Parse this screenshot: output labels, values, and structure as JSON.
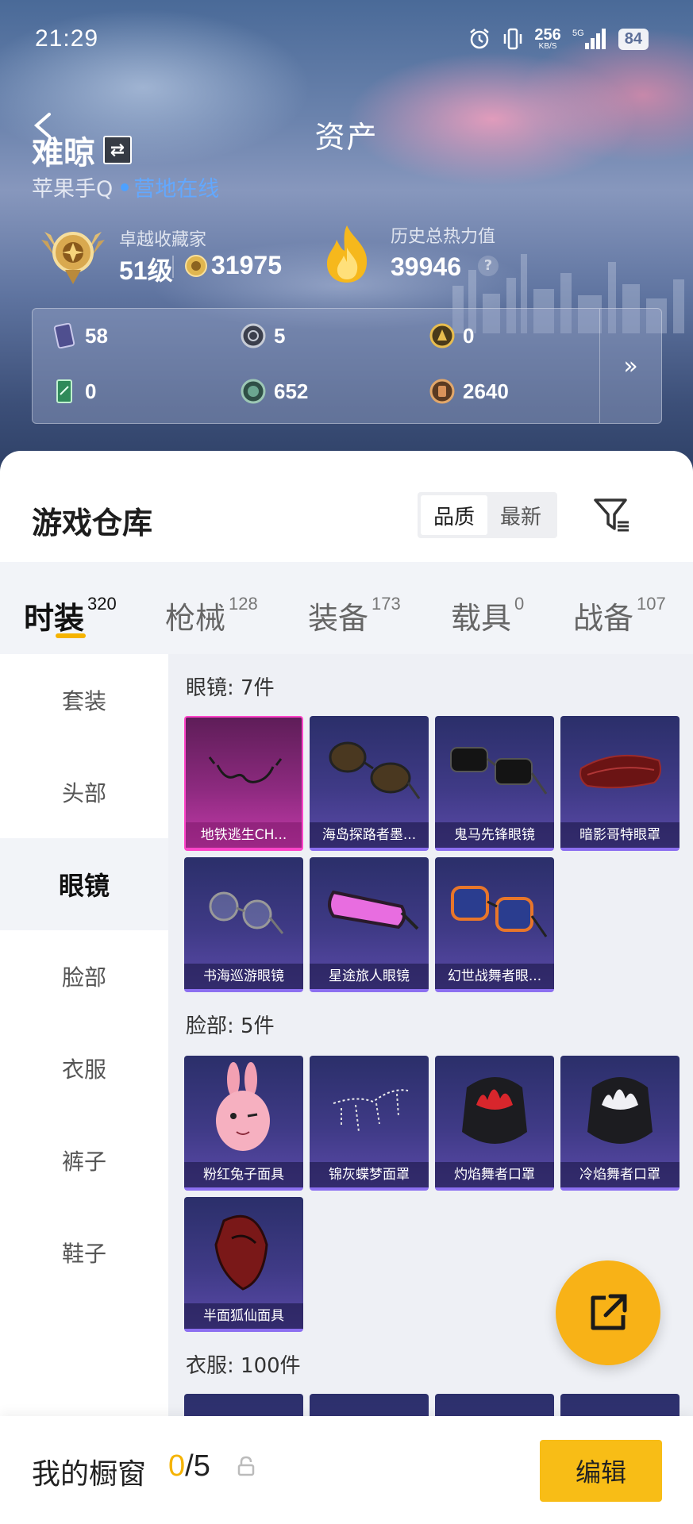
{
  "status_bar": {
    "time": "21:29",
    "net_speed": "256",
    "net_unit": "KB/S",
    "signal": "5G",
    "battery": "84"
  },
  "header": {
    "title": "资产",
    "username": "难晾",
    "swap_icon": "⇄",
    "platform": "苹果手Q",
    "online_status": "营地在线",
    "rank_title": "卓越收藏家",
    "rank_level": "51级",
    "points": "31975",
    "heat_title": "历史总热力值",
    "heat_value": "39946",
    "help": "?"
  },
  "currencies": [
    {
      "icon": "purple-card-icon",
      "value": "58"
    },
    {
      "icon": "silver-token-icon",
      "value": "5"
    },
    {
      "icon": "gold-token-icon",
      "value": "0"
    },
    {
      "icon": "green-card-icon",
      "value": "0"
    },
    {
      "icon": "green-coin-icon",
      "value": "652"
    },
    {
      "icon": "bronze-coin-icon",
      "value": "2640"
    }
  ],
  "more_label": "»",
  "warehouse": {
    "title": "游戏仓库",
    "sort_options": [
      "品质",
      "最新"
    ],
    "active_sort": "品质"
  },
  "tabs": [
    {
      "label": "时装",
      "count": "320"
    },
    {
      "label": "枪械",
      "count": "128"
    },
    {
      "label": "装备",
      "count": "173"
    },
    {
      "label": "载具",
      "count": "0"
    },
    {
      "label": "战备",
      "count": "107"
    }
  ],
  "sidenav": [
    "套装",
    "头部",
    "眼镜",
    "脸部",
    "衣服",
    "裤子",
    "鞋子"
  ],
  "active_nav": "眼镜",
  "sections": {
    "glasses": {
      "title": "眼镜: 7件",
      "items": [
        "地铁逃生CH...",
        "海岛探路者墨...",
        "鬼马先锋眼镜",
        "暗影哥特眼罩",
        "书海巡游眼镜",
        "星途旅人眼镜",
        "幻世战舞者眼..."
      ]
    },
    "face": {
      "title": "脸部: 5件",
      "items": [
        "粉红兔子面具",
        "锦灰蝶梦面罩",
        "灼焰舞者口罩",
        "冷焰舞者口罩",
        "半面狐仙面具"
      ]
    },
    "clothes": {
      "title": "衣服: 100件"
    }
  },
  "footer": {
    "title": "我的橱窗",
    "count": "0",
    "separator": "/",
    "max": "5",
    "edit_label": "编辑"
  },
  "colors": {
    "accent": "#f5b300",
    "link": "#62a8ff",
    "rare_border": "#8c6ff0",
    "pink_border": "#ff45c8"
  }
}
